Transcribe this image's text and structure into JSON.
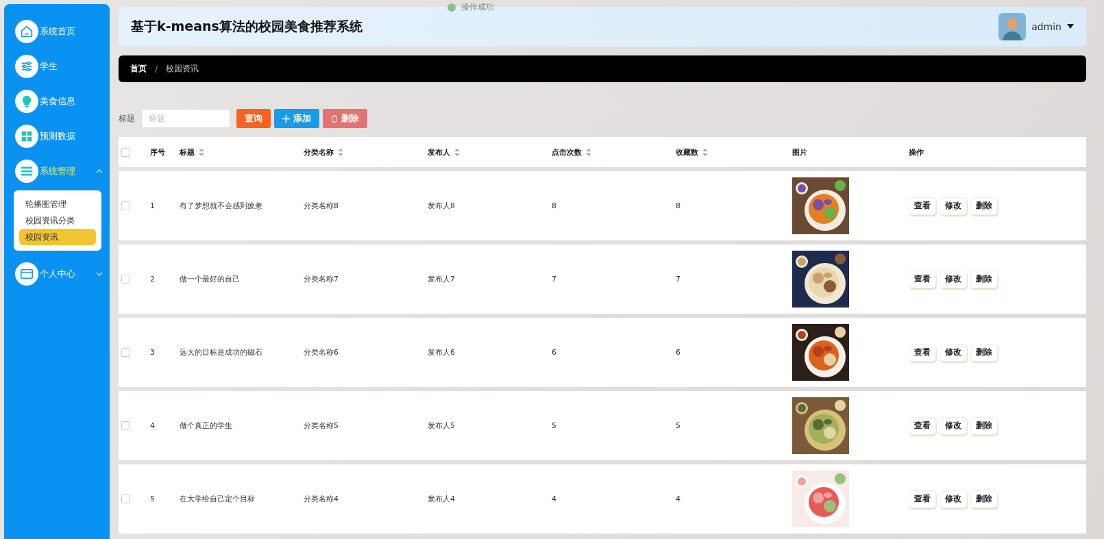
{
  "toast": {
    "text": "操作成功"
  },
  "sidebar": {
    "items": [
      {
        "label": "系统首页",
        "kind": "link"
      },
      {
        "label": "学生",
        "kind": "link"
      },
      {
        "label": "美食信息",
        "kind": "link"
      },
      {
        "label": "预测数据",
        "kind": "link"
      },
      {
        "label": "系统管理",
        "kind": "group",
        "expanded": true,
        "children": [
          {
            "label": "轮播图管理",
            "selected": false
          },
          {
            "label": "校园资讯分类",
            "selected": false
          },
          {
            "label": "校园资讯",
            "selected": true
          }
        ]
      },
      {
        "label": "个人中心",
        "kind": "group",
        "expanded": false
      }
    ]
  },
  "header": {
    "title": "基于k-means算法的校园美食推荐系统",
    "user": "admin"
  },
  "breadcrumb": {
    "separator": "/",
    "items": [
      "首页",
      "校园资讯"
    ]
  },
  "search": {
    "label": "标题",
    "placeholder": "标题",
    "buttons": [
      {
        "label": "查询",
        "kind": "search",
        "disabled": false
      },
      {
        "label": "添加",
        "kind": "add",
        "disabled": false
      },
      {
        "label": "删除",
        "kind": "delete",
        "disabled": true
      }
    ]
  },
  "table": {
    "select_all": {
      "checked": false
    },
    "columns": [
      {
        "label": "序号",
        "sortable": false
      },
      {
        "label": "标题",
        "sortable": true
      },
      {
        "label": "分类名称",
        "sortable": true
      },
      {
        "label": "发布人",
        "sortable": true
      },
      {
        "label": "点击次数",
        "sortable": true
      },
      {
        "label": "收藏数",
        "sortable": true
      },
      {
        "label": "图片",
        "sortable": false
      },
      {
        "label": "操作",
        "sortable": false
      }
    ],
    "rows": [
      {
        "checked": false,
        "cells": [
          "1",
          "有了梦想就不会感到疲惫",
          "分类名称8",
          "发布人8",
          "8",
          "8"
        ],
        "actions": [
          "查看",
          "修改",
          "删除"
        ]
      },
      {
        "checked": false,
        "cells": [
          "2",
          "做一个最好的自己",
          "分类名称7",
          "发布人7",
          "7",
          "7"
        ],
        "actions": [
          "查看",
          "修改",
          "删除"
        ]
      },
      {
        "checked": false,
        "cells": [
          "3",
          "远大的目标是成功的磁石",
          "分类名称6",
          "发布人6",
          "6",
          "6"
        ],
        "actions": [
          "查看",
          "修改",
          "删除"
        ]
      },
      {
        "checked": false,
        "cells": [
          "4",
          "做个真正的学生",
          "分类名称5",
          "发布人5",
          "5",
          "5"
        ],
        "actions": [
          "查看",
          "修改",
          "删除"
        ]
      },
      {
        "checked": false,
        "cells": [
          "5",
          "在大学给自己定个目标",
          "分类名称4",
          "发布人4",
          "4",
          "4"
        ],
        "actions": [
          "查看",
          "修改",
          "删除"
        ]
      }
    ]
  }
}
